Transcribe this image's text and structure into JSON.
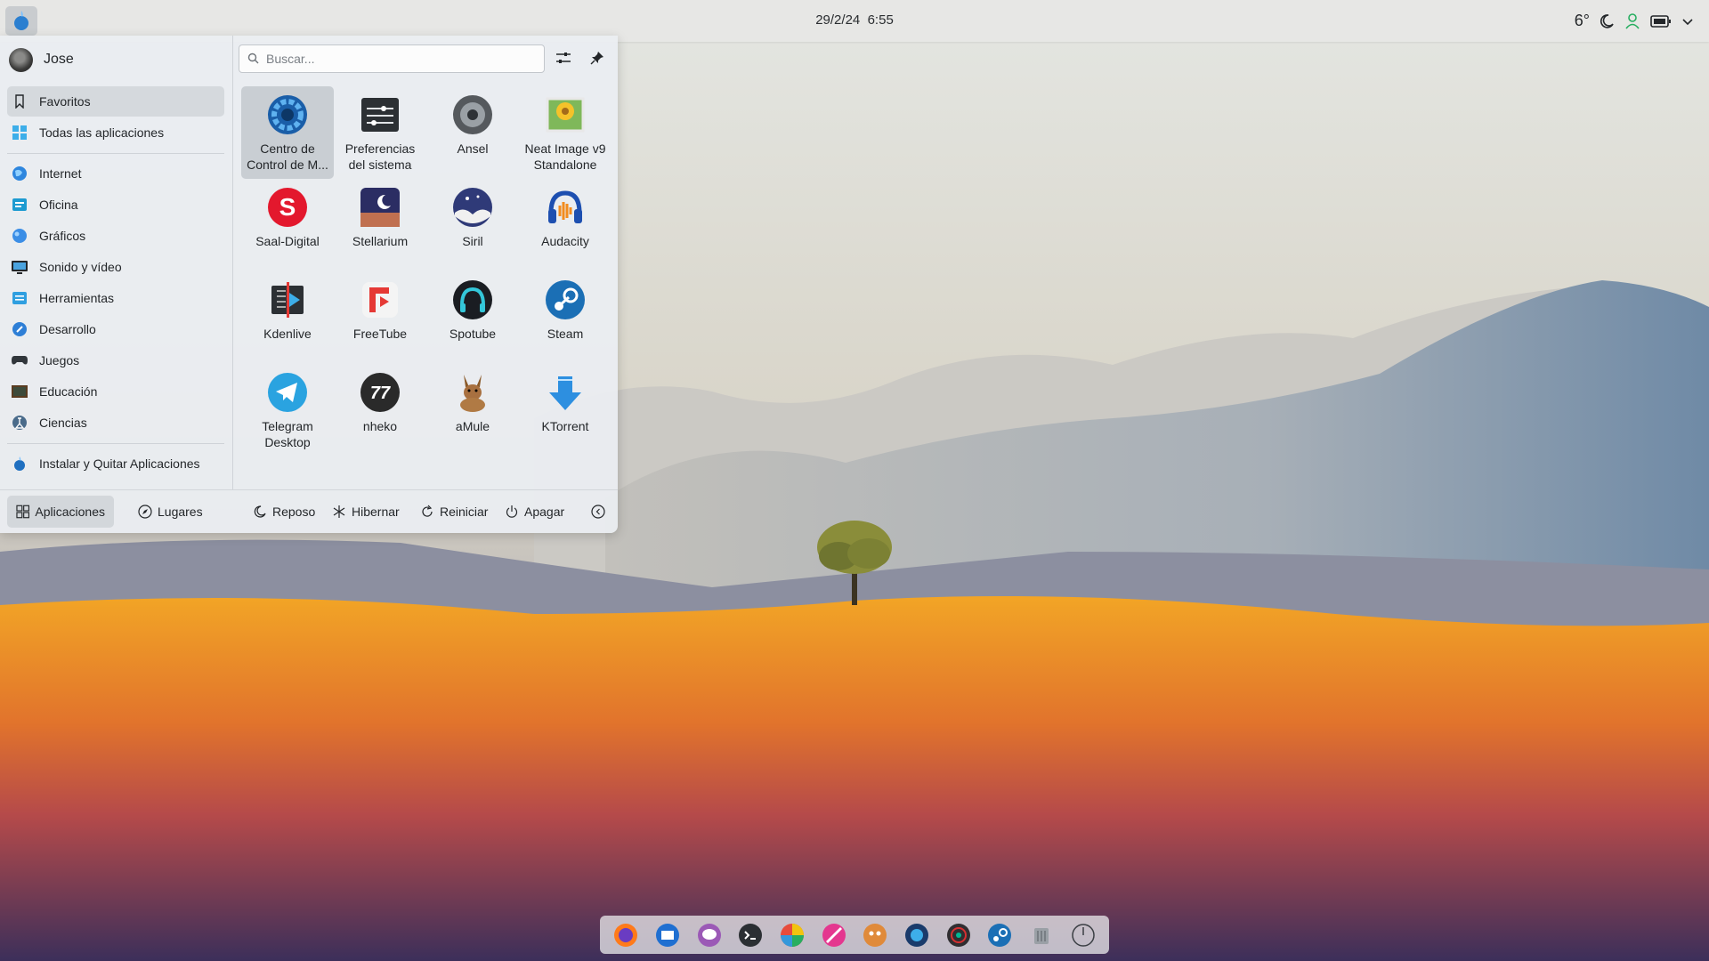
{
  "panel": {
    "date": "29/2/24",
    "time": "6:55",
    "temperature": "6°"
  },
  "user": {
    "name": "Jose"
  },
  "search": {
    "placeholder": "Buscar..."
  },
  "categories": [
    {
      "label": "Favoritos",
      "icon": "bookmark-icon",
      "selected": true
    },
    {
      "label": "Todas las aplicaciones",
      "icon": "grid-icon"
    },
    {
      "label": "Internet",
      "icon": "globe-icon"
    },
    {
      "label": "Oficina",
      "icon": "office-icon"
    },
    {
      "label": "Gráficos",
      "icon": "graphics-icon"
    },
    {
      "label": "Sonido y vídeo",
      "icon": "multimedia-icon"
    },
    {
      "label": "Herramientas",
      "icon": "tools-icon"
    },
    {
      "label": "Desarrollo",
      "icon": "development-icon"
    },
    {
      "label": "Juegos",
      "icon": "gamepad-icon"
    },
    {
      "label": "Educación",
      "icon": "education-icon"
    },
    {
      "label": "Ciencias",
      "icon": "science-icon"
    },
    {
      "label": "Instalar y Quitar Aplicaciones",
      "icon": "package-installer-icon"
    }
  ],
  "apps": [
    {
      "label": "Centro de Control de M...",
      "icon": "control-center-icon"
    },
    {
      "label": "Preferencias del sistema",
      "icon": "system-settings-icon"
    },
    {
      "label": "Ansel",
      "icon": "ansel-icon"
    },
    {
      "label": "Neat Image v9 Standalone",
      "icon": "neat-image-icon"
    },
    {
      "label": "Saal-Digital",
      "icon": "saal-digital-icon"
    },
    {
      "label": "Stellarium",
      "icon": "stellarium-icon"
    },
    {
      "label": "Siril",
      "icon": "siril-icon"
    },
    {
      "label": "Audacity",
      "icon": "audacity-icon"
    },
    {
      "label": "Kdenlive",
      "icon": "kdenlive-icon"
    },
    {
      "label": "FreeTube",
      "icon": "freetube-icon"
    },
    {
      "label": "Spotube",
      "icon": "spotube-icon"
    },
    {
      "label": "Steam",
      "icon": "steam-icon"
    },
    {
      "label": "Telegram Desktop",
      "icon": "telegram-icon"
    },
    {
      "label": "nheko",
      "icon": "nheko-icon"
    },
    {
      "label": "aMule",
      "icon": "amule-icon"
    },
    {
      "label": "KTorrent",
      "icon": "ktorrent-icon"
    }
  ],
  "footer": {
    "applications": "Aplicaciones",
    "places": "Lugares",
    "sleep": "Reposo",
    "hibernate": "Hibernar",
    "restart": "Reiniciar",
    "shutdown": "Apagar"
  },
  "dock": [
    "firefox-icon",
    "thunderbird-icon",
    "chat-icon",
    "terminal-icon",
    "darktable-icon",
    "krita-icon",
    "gimp-icon",
    "browser-icon",
    "obs-icon",
    "steam-icon",
    "trash-icon",
    "power-icon"
  ],
  "colors": {
    "accent": "#3daee9",
    "wallpaper_sand": "#e8a030",
    "wallpaper_sky": "#dcd8cc"
  }
}
